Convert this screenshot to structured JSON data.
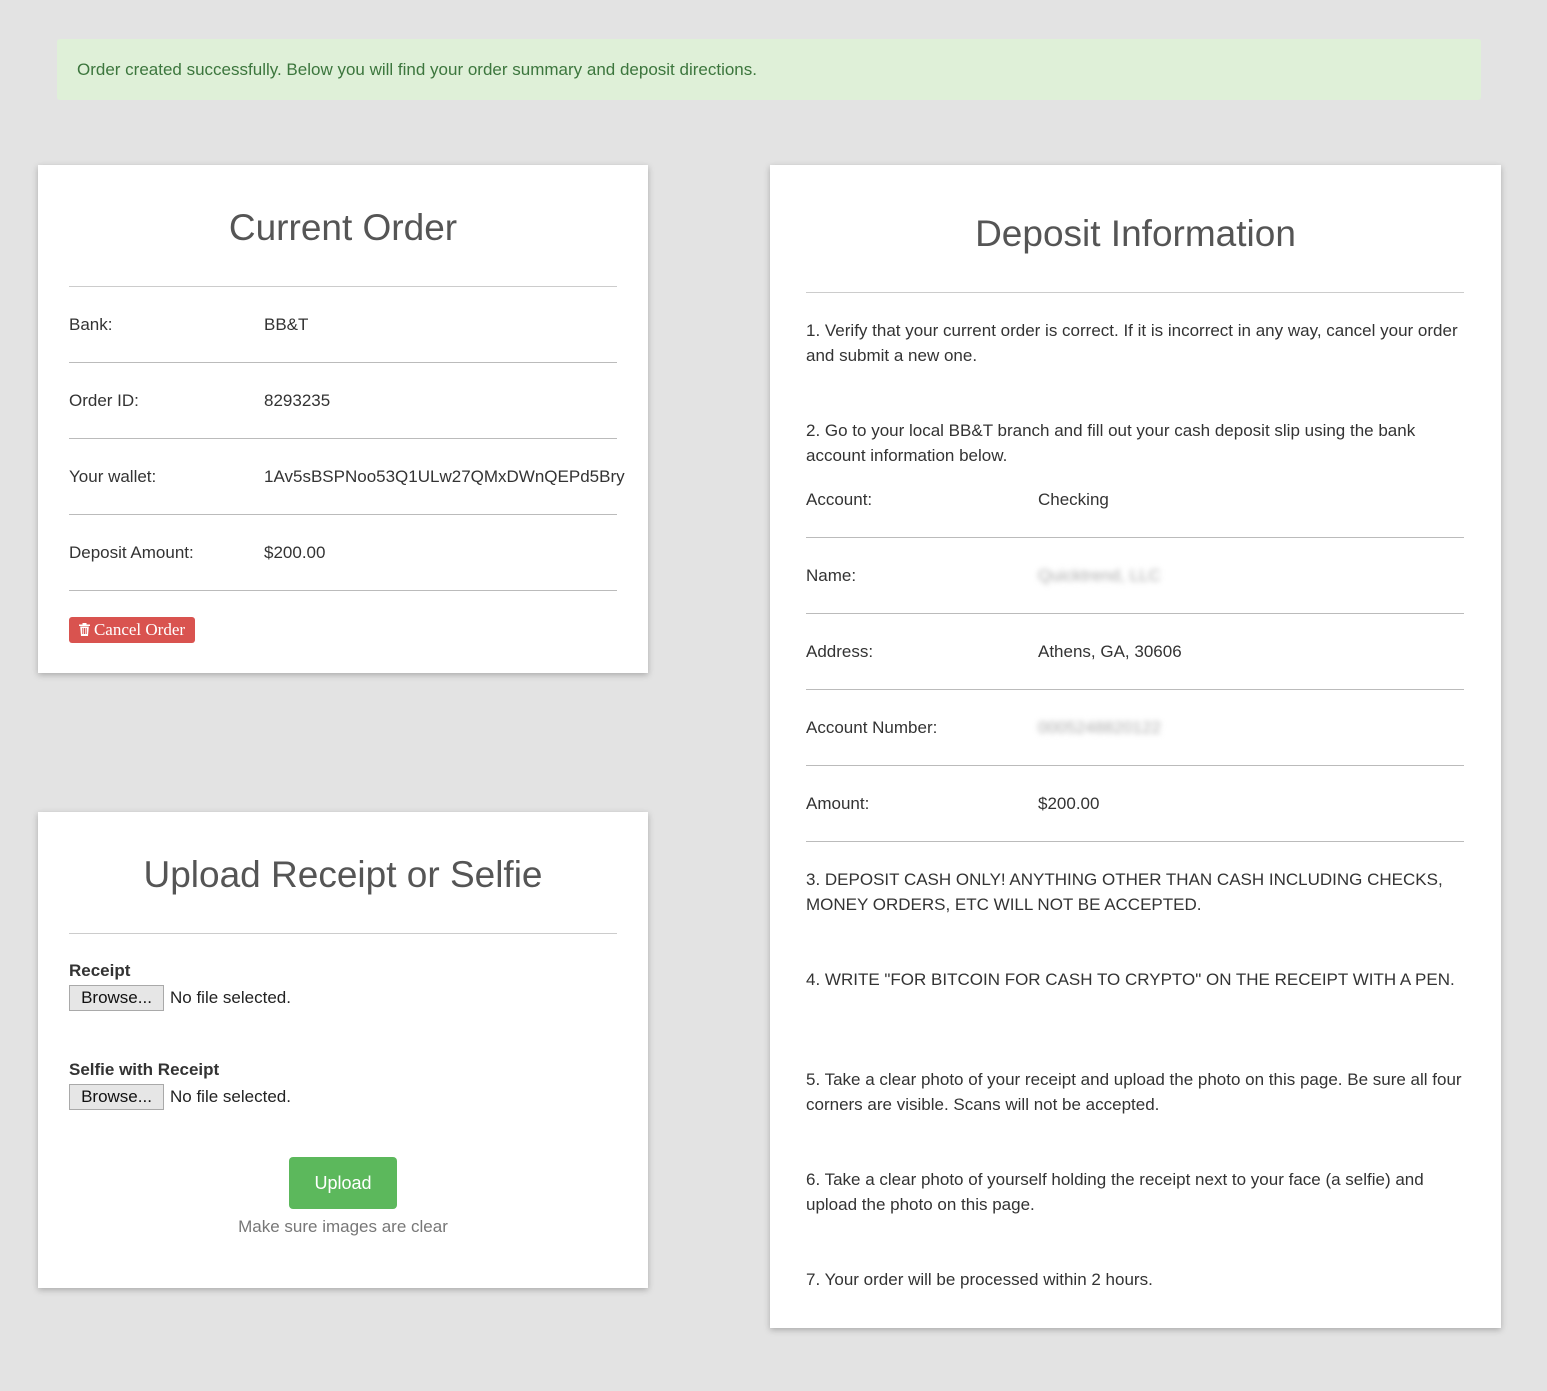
{
  "alert": {
    "message": "Order created successfully. Below you will find your order summary and deposit directions."
  },
  "order": {
    "title": "Current Order",
    "rows": [
      {
        "label": "Bank:",
        "value": "BB&T"
      },
      {
        "label": "Order ID:",
        "value": "8293235"
      },
      {
        "label": "Your wallet:",
        "value": "1Av5sBSPNoo53Q1ULw27QMxDWnQEPd5Bry"
      },
      {
        "label": "Deposit Amount:",
        "value": "$200.00"
      }
    ],
    "cancel_label": "Cancel Order",
    "cancel_icon": "trash-icon"
  },
  "upload": {
    "title": "Upload Receipt or Selfie",
    "receipt_label": "Receipt",
    "selfie_label": "Selfie with Receipt",
    "browse_label": "Browse...",
    "no_file": "No file selected.",
    "upload_label": "Upload",
    "note": "Make sure images are clear"
  },
  "deposit": {
    "title": "Deposit Information",
    "step1": "1. Verify that your current order is correct. If it is incorrect in any way, cancel your order and submit a new one.",
    "step2": "2. Go to your local BB&T branch and fill out your cash deposit slip using the bank account information below.",
    "rows": [
      {
        "label": "Account:",
        "value": "Checking"
      },
      {
        "label": "Name:",
        "value": "Quicktrend, LLC"
      },
      {
        "label": "Address:",
        "value": "Athens, GA, 30606"
      },
      {
        "label": "Account Number:",
        "value": "0005248820122"
      },
      {
        "label": "Amount:",
        "value": "$200.00"
      }
    ],
    "step3": "3. DEPOSIT CASH ONLY! ANYTHING OTHER THAN CASH INCLUDING CHECKS, MONEY ORDERS, ETC WILL NOT BE ACCEPTED.",
    "step4": "4. WRITE \"FOR BITCOIN FOR CASH TO CRYPTO\" ON THE RECEIPT WITH A PEN.",
    "step5": "5. Take a clear photo of your receipt and upload the photo on this page. Be sure all four corners are visible. Scans will not be accepted.",
    "step6": "6. Take a clear photo of yourself holding the receipt next to your face (a selfie) and upload the photo on this page.",
    "step7": "7. Your order will be processed within 2 hours."
  },
  "colors": {
    "alert_bg": "#dff0d8",
    "alert_text": "#3c763d",
    "cancel_button": "#d9534f",
    "upload_button": "#5cb85c",
    "page_bg": "#e3e3e3"
  }
}
